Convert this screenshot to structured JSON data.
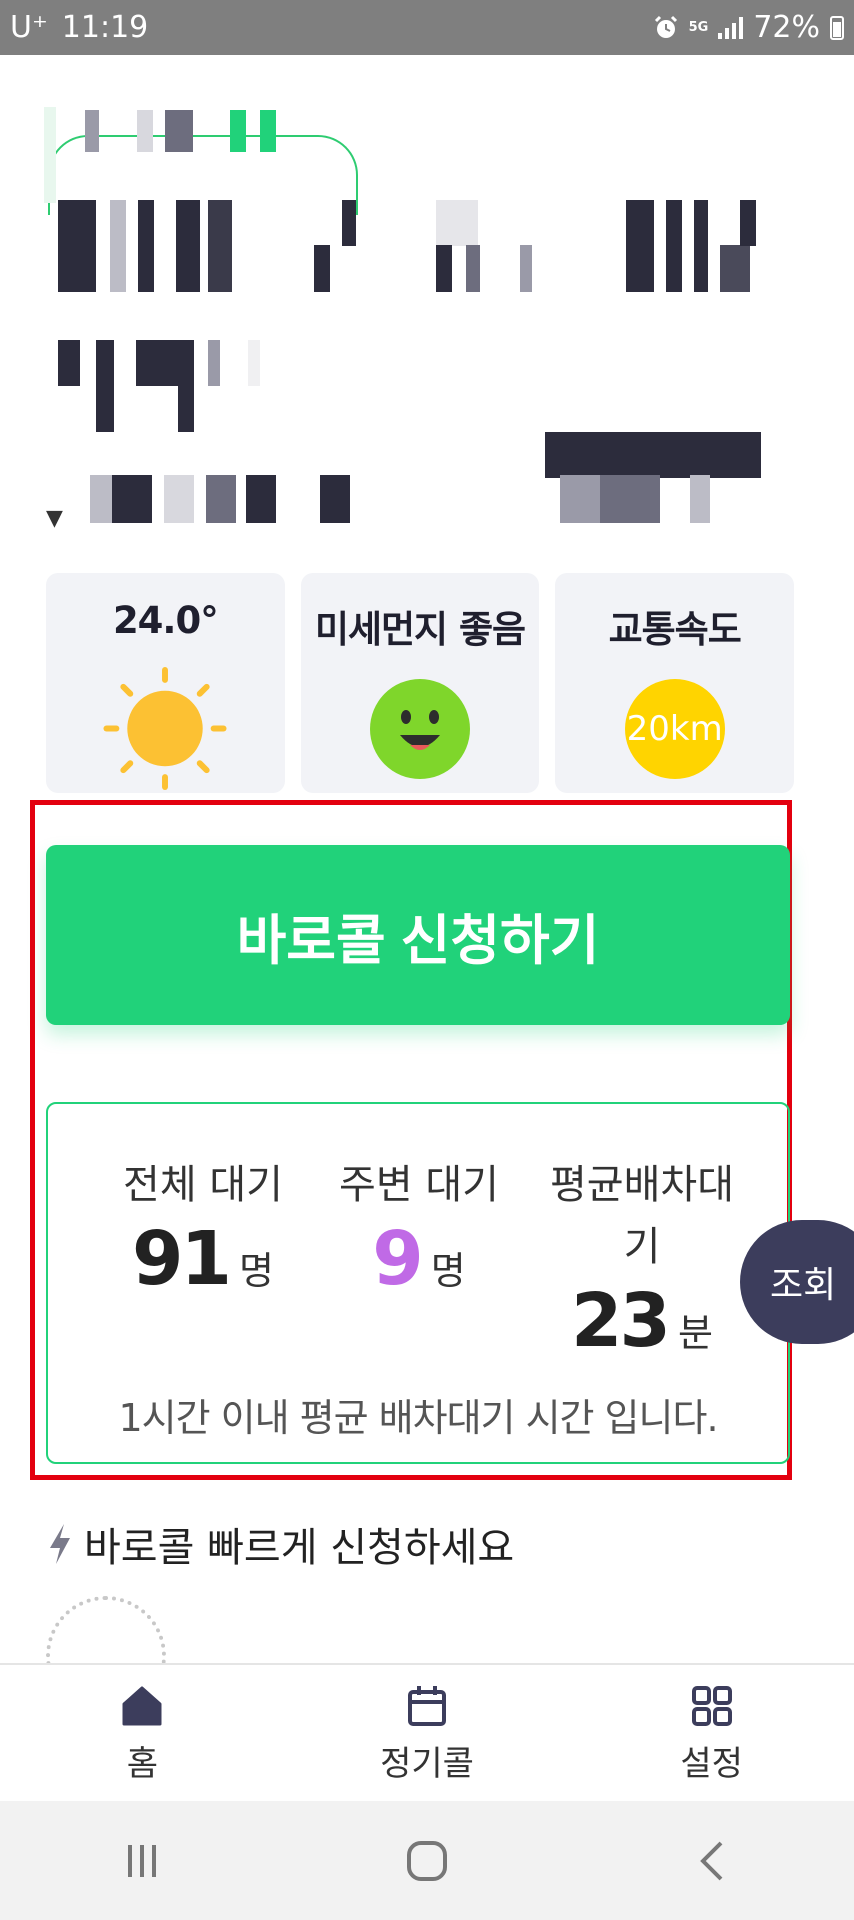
{
  "status_bar": {
    "carrier": "U⁺",
    "time": "11:19",
    "network": "5G",
    "battery": "72%"
  },
  "weather_cards": [
    {
      "title": "24.0°",
      "icon": "sun-icon"
    },
    {
      "title": "미세먼지 좋음",
      "icon": "smile-face-icon"
    },
    {
      "title": "교통속도",
      "value": "20km"
    }
  ],
  "call_button_label": "바로콜 신청하기",
  "wait_stats": {
    "total": {
      "label": "전체 대기",
      "value": "91",
      "unit": "명"
    },
    "nearby": {
      "label": "주변 대기",
      "value": "9",
      "unit": "명"
    },
    "average": {
      "label_line1": "평균배차대",
      "label_line2": "기",
      "value": "23",
      "unit": "분"
    },
    "note": "1시간 이내 평균 배차대기 시간 입니다."
  },
  "inquiry_button": "조회",
  "quick_section_title": "바로콜 빠르게 신청하세요",
  "bottom_nav": [
    {
      "label": "홈",
      "icon": "home-icon"
    },
    {
      "label": "정기콜",
      "icon": "calendar-icon"
    },
    {
      "label": "설정",
      "icon": "grid-icon"
    }
  ],
  "colors": {
    "accent_green": "#21d27a",
    "highlight_red": "#e3000f",
    "purple": "#c06ae6",
    "navy": "#3c3d5c"
  }
}
